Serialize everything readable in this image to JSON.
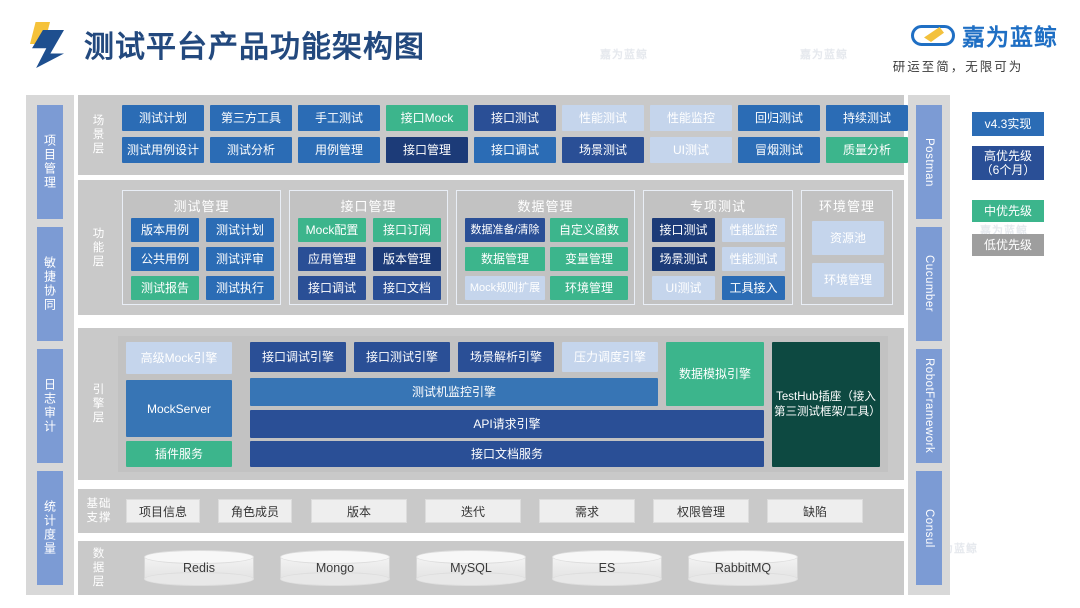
{
  "header": {
    "title": "测试平台产品功能架构图",
    "brand_name": "嘉为蓝鲸",
    "brand_tagline": "研运至简，无限可为",
    "logo_icon": "lightning-shard-logo",
    "brand_icon": "whale-cloud-icon"
  },
  "watermark": {
    "text": "嘉为蓝鲸"
  },
  "left_rail": {
    "items": [
      {
        "label": "项目管理"
      },
      {
        "label": "敏捷协同"
      },
      {
        "label": "日志审计"
      },
      {
        "label": "统计度量"
      }
    ]
  },
  "right_rail": {
    "items": [
      {
        "label": "Postman"
      },
      {
        "label": "Cucumber"
      },
      {
        "label": "RobotFramework"
      },
      {
        "label": "Consul"
      }
    ]
  },
  "legend": {
    "items": [
      {
        "label": "v4.3实现",
        "color": "#2b6cb5",
        "style": "c-v43"
      },
      {
        "label": "高优先级\n（6个月）",
        "color": "#2a4f96",
        "style": "c-high"
      },
      {
        "label": "中优先级",
        "color": "#3cb58c",
        "style": "c-mid"
      },
      {
        "label": "低优先级",
        "color": "#9e9e9e",
        "style": "c-gray"
      }
    ],
    "item0": "v4.3实现",
    "item1_line1": "高优先级",
    "item1_line2": "（6个月）",
    "item2": "中优先级",
    "item3": "低优先级"
  },
  "layers": {
    "scene": {
      "label_line1": "场",
      "label_line2": "景",
      "label_line3": "层",
      "row1": [
        {
          "label": "测试计划",
          "style": "c-v43"
        },
        {
          "label": "第三方工具",
          "style": "c-v43"
        },
        {
          "label": "手工测试",
          "style": "c-v43"
        },
        {
          "label": "接口Mock",
          "style": "c-mid"
        },
        {
          "label": "接口测试",
          "style": "c-high"
        },
        {
          "label": "性能测试",
          "style": "c-low"
        },
        {
          "label": "性能监控",
          "style": "c-low"
        },
        {
          "label": "回归测试",
          "style": "c-v43"
        },
        {
          "label": "持续测试",
          "style": "c-v43"
        }
      ],
      "row2": [
        {
          "label": "测试用例设计",
          "style": "c-v43"
        },
        {
          "label": "测试分析",
          "style": "c-v43"
        },
        {
          "label": "用例管理",
          "style": "c-v43"
        },
        {
          "label": "接口管理",
          "style": "c-high2"
        },
        {
          "label": "接口调试",
          "style": "c-v43"
        },
        {
          "label": "场景测试",
          "style": "c-high"
        },
        {
          "label": "UI测试",
          "style": "c-low"
        },
        {
          "label": "冒烟测试",
          "style": "c-v43"
        },
        {
          "label": "质量分析",
          "style": "c-mid"
        }
      ]
    },
    "function": {
      "label_line1": "功",
      "label_line2": "能",
      "label_line3": "层",
      "groups": [
        {
          "title": "测试管理",
          "chips": [
            {
              "label": "版本用例",
              "style": "c-v43"
            },
            {
              "label": "测试计划",
              "style": "c-v43"
            },
            {
              "label": "公共用例",
              "style": "c-v43"
            },
            {
              "label": "测试评审",
              "style": "c-v43"
            },
            {
              "label": "测试报告",
              "style": "c-mid"
            },
            {
              "label": "测试执行",
              "style": "c-v43"
            }
          ]
        },
        {
          "title": "接口管理",
          "chips": [
            {
              "label": "Mock配置",
              "style": "c-mid"
            },
            {
              "label": "接口订阅",
              "style": "c-mid"
            },
            {
              "label": "应用管理",
              "style": "c-high"
            },
            {
              "label": "版本管理",
              "style": "c-high2"
            },
            {
              "label": "接口调试",
              "style": "c-high"
            },
            {
              "label": "接口文档",
              "style": "c-high"
            }
          ]
        },
        {
          "title": "数据管理",
          "chips": [
            {
              "label": "数据准备/清除",
              "style": "c-high"
            },
            {
              "label": "自定义函数",
              "style": "c-mid"
            },
            {
              "label": "数据管理",
              "style": "c-mid"
            },
            {
              "label": "变量管理",
              "style": "c-mid"
            },
            {
              "label": "Mock规则扩展",
              "style": "c-low"
            },
            {
              "label": "环境管理",
              "style": "c-mid"
            }
          ]
        },
        {
          "title": "专项测试",
          "chips": [
            {
              "label": "接口测试",
              "style": "c-high2"
            },
            {
              "label": "性能监控",
              "style": "c-low"
            },
            {
              "label": "场景测试",
              "style": "c-high2"
            },
            {
              "label": "性能测试",
              "style": "c-low"
            },
            {
              "label": "UI测试",
              "style": "c-low"
            },
            {
              "label": "工具接入",
              "style": "c-v43"
            }
          ]
        },
        {
          "title": "环境管理",
          "chips": [
            {
              "label": "资源池",
              "style": "c-low"
            },
            {
              "label": "环境管理",
              "style": "c-low"
            }
          ]
        }
      ]
    },
    "engine": {
      "label_line1": "引",
      "label_line2": "擎",
      "label_line3": "层",
      "left_column": [
        {
          "label": "高级Mock引擎",
          "style": "c-low"
        },
        {
          "label": "MockServer",
          "style": "c-steel"
        },
        {
          "label": "插件服务",
          "style": "c-mid"
        }
      ],
      "top_engines": [
        {
          "label": "接口调试引擎",
          "style": "c-high"
        },
        {
          "label": "接口测试引擎",
          "style": "c-high"
        },
        {
          "label": "场景解析引擎",
          "style": "c-high"
        },
        {
          "label": "压力调度引擎",
          "style": "c-low"
        }
      ],
      "bars": [
        {
          "label": "测试机监控引擎",
          "style": "c-steel"
        },
        {
          "label": "API请求引擎",
          "style": "c-high"
        },
        {
          "label": "接口文档服务",
          "style": "c-high"
        }
      ],
      "data_sim": {
        "label": "数据模拟引擎",
        "style": "c-mid"
      },
      "testhub": {
        "label": "TestHub插座（接入第三测试框架/工具）",
        "style": "c-teal"
      }
    },
    "base": {
      "label_line1": "基础",
      "label_line2": "支撑",
      "items": [
        {
          "label": "项目信息"
        },
        {
          "label": "角色成员"
        },
        {
          "label": "版本"
        },
        {
          "label": "迭代"
        },
        {
          "label": "需求"
        },
        {
          "label": "权限管理"
        },
        {
          "label": "缺陷"
        }
      ]
    },
    "data": {
      "label_line1": "数",
      "label_line2": "据",
      "label_line3": "层",
      "items": [
        {
          "label": "Redis"
        },
        {
          "label": "Mongo"
        },
        {
          "label": "MySQL"
        },
        {
          "label": "ES"
        },
        {
          "label": "RabbitMQ"
        }
      ]
    }
  }
}
